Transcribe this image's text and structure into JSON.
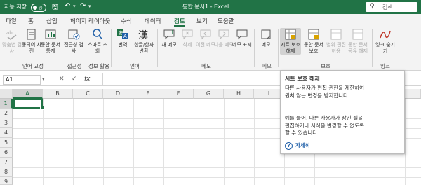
{
  "titlebar": {
    "autosave_label": "자동 저장",
    "autosave_state": "끔",
    "doc_title": "통합 문서1 - Excel",
    "search_placeholder": "검색"
  },
  "tabs": [
    "파일",
    "홈",
    "삽입",
    "페이지 레이아웃",
    "수식",
    "데이터",
    "검토",
    "보기",
    "도움말"
  ],
  "active_tab": "검토",
  "ribbon": {
    "buttons": [
      {
        "label": "맞춤법 검사",
        "dim": true
      },
      {
        "label": "동의어 사전",
        "dim": false
      },
      {
        "label": "통합 문서 통계",
        "dim": false
      },
      {
        "label": "접근성 검사",
        "dim": false
      },
      {
        "label": "스마트 조회",
        "dim": false
      },
      {
        "label": "번역",
        "dim": false
      },
      {
        "label": "한글/한자 변환",
        "dim": false
      },
      {
        "label": "새 메모",
        "dim": false
      },
      {
        "label": "삭제",
        "dim": true
      },
      {
        "label": "이전 메모",
        "dim": true
      },
      {
        "label": "다음 메모",
        "dim": true
      },
      {
        "label": "메모 표시",
        "dim": false
      },
      {
        "label": "메모",
        "dim": false
      },
      {
        "label": "시트 보호 해제",
        "dim": false
      },
      {
        "label": "통합 문서 보호",
        "dim": false
      },
      {
        "label": "범위 편집 허용",
        "dim": true
      },
      {
        "label": "통합 문서 공유 해제",
        "dim": true
      },
      {
        "label": "잉크 숨기기",
        "dim": false
      }
    ],
    "groups": [
      "언어 교정",
      "접근성",
      "정보 활용",
      "언어",
      "메모",
      "메모",
      "보호",
      "잉크"
    ]
  },
  "formula_bar": {
    "name_box": "A1",
    "fx": "fx"
  },
  "columns": [
    "A",
    "B",
    "C",
    "D",
    "E",
    "F",
    "G",
    "H",
    "I",
    "J",
    "K",
    "L",
    "M"
  ],
  "rows": [
    "1",
    "2",
    "3",
    "4",
    "5",
    "6",
    "7",
    "8",
    "9"
  ],
  "tooltip": {
    "title": "시트 보호 해제",
    "body": "다른 사용자가 편집 권한을 제한하여 원치 않는 변경을 방지합니다.",
    "example": "예를 들어, 다른 사용자가 잠긴 셀을 편집하거나 서식을 변경할 수 없도록 할 수 있습니다.",
    "help": "자세히"
  },
  "colors": {
    "accent": "#217346",
    "link": "#1f5fa8"
  }
}
